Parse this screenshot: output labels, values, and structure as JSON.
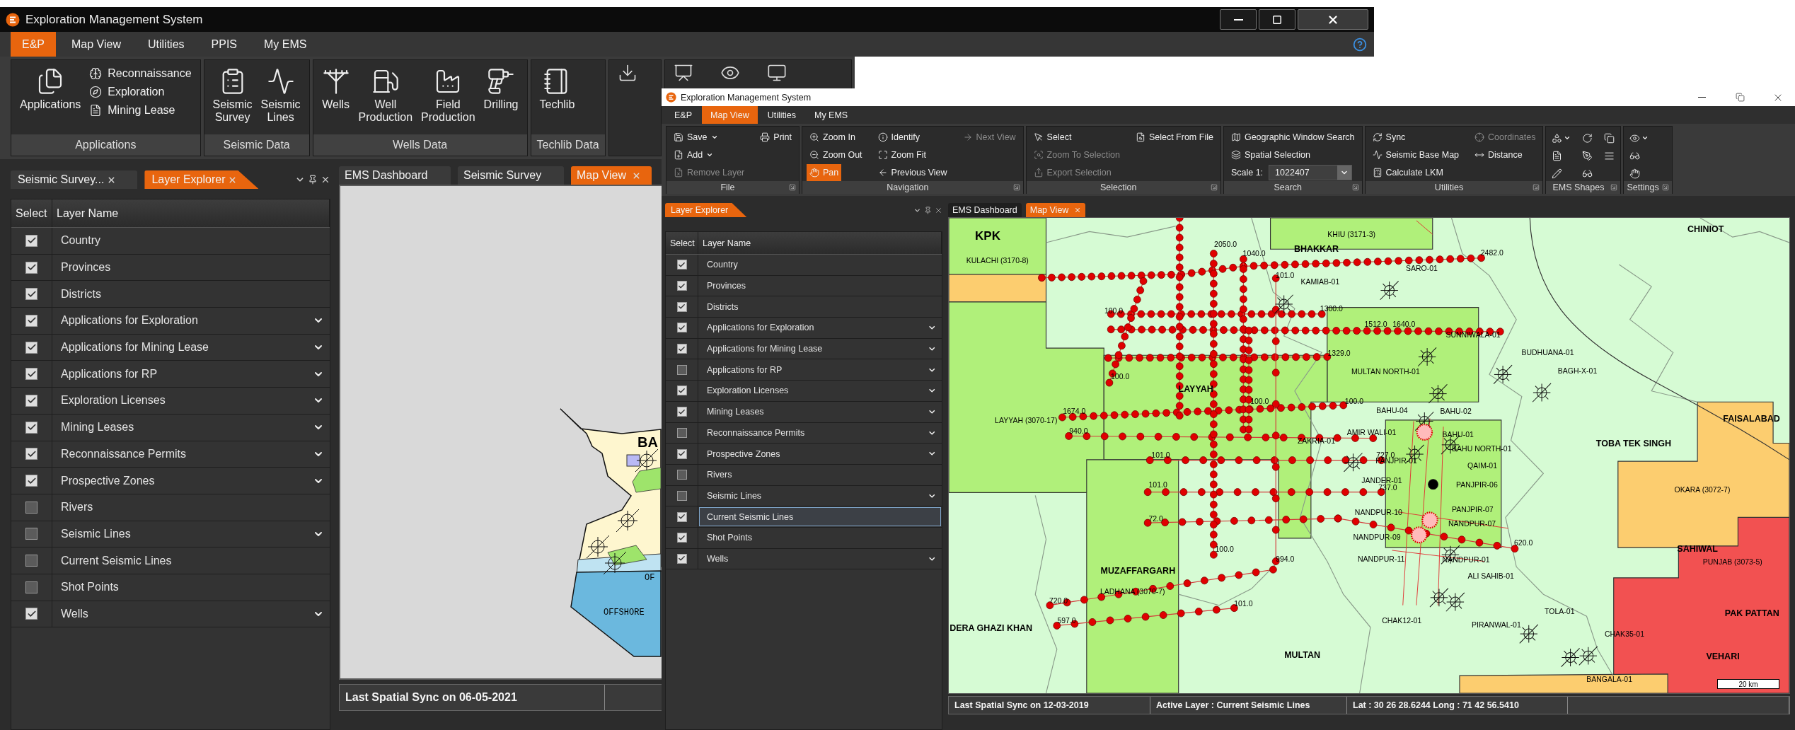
{
  "back_window": {
    "title": "Exploration Management System",
    "menu_tabs": [
      {
        "label": "E&P",
        "selected": true
      },
      {
        "label": "Map View",
        "selected": false
      },
      {
        "label": "Utilities",
        "selected": false
      },
      {
        "label": "PPIS",
        "selected": false
      },
      {
        "label": "My EMS",
        "selected": false
      }
    ],
    "ribbon_groups": [
      {
        "label": "Applications",
        "buttons": [
          {
            "label": "Applications",
            "kind": "large"
          },
          {
            "label": "Reconnaissance",
            "kind": "small"
          },
          {
            "label": "Exploration",
            "kind": "small"
          },
          {
            "label": "Mining Lease",
            "kind": "small"
          }
        ]
      },
      {
        "label": "Seismic Data",
        "buttons": [
          {
            "label": "Seismic Survey",
            "kind": "large"
          },
          {
            "label": "Seismic Lines",
            "kind": "large"
          }
        ]
      },
      {
        "label": "Wells Data",
        "buttons": [
          {
            "label": "Wells",
            "kind": "large"
          },
          {
            "label": "Well Production",
            "kind": "large"
          },
          {
            "label": "Field Production",
            "kind": "large"
          },
          {
            "label": "Drilling",
            "kind": "large"
          }
        ]
      },
      {
        "label": "Techlib Data",
        "buttons": [
          {
            "label": "Techlib",
            "kind": "large"
          }
        ]
      }
    ],
    "panel_tabs": [
      {
        "label": "Seismic Survey...",
        "selected": false
      },
      {
        "label": "Layer Explorer",
        "selected": true
      }
    ],
    "layer_table": {
      "columns": [
        "Select",
        "Layer Name"
      ],
      "layers": [
        {
          "name": "Country",
          "checked": true,
          "expandable": false,
          "selected": false
        },
        {
          "name": "Provinces",
          "checked": true,
          "expandable": false,
          "selected": false
        },
        {
          "name": "Districts",
          "checked": true,
          "expandable": false,
          "selected": false
        },
        {
          "name": "Applications for Exploration",
          "checked": true,
          "expandable": true,
          "selected": false
        },
        {
          "name": "Applications for Mining Lease",
          "checked": true,
          "expandable": true,
          "selected": false
        },
        {
          "name": "Applications for RP",
          "checked": true,
          "expandable": true,
          "selected": false
        },
        {
          "name": "Exploration Licenses",
          "checked": true,
          "expandable": true,
          "selected": false
        },
        {
          "name": "Mining Leases",
          "checked": true,
          "expandable": true,
          "selected": false
        },
        {
          "name": "Reconnaissance Permits",
          "checked": true,
          "expandable": true,
          "selected": false
        },
        {
          "name": "Prospective Zones",
          "checked": true,
          "expandable": true,
          "selected": false
        },
        {
          "name": "Rivers",
          "checked": false,
          "expandable": false,
          "selected": false
        },
        {
          "name": "Seismic Lines",
          "checked": false,
          "expandable": true,
          "selected": false
        },
        {
          "name": "Current Seismic Lines",
          "checked": false,
          "expandable": false,
          "selected": false
        },
        {
          "name": "Shot Points",
          "checked": false,
          "expandable": false,
          "selected": false
        },
        {
          "name": "Wells",
          "checked": true,
          "expandable": true,
          "selected": false
        }
      ]
    },
    "document_tabs": [
      {
        "label": "EMS Dashboard",
        "selected": false
      },
      {
        "label": "Seismic Survey",
        "selected": false
      },
      {
        "label": "Map View",
        "selected": true
      }
    ],
    "map_labels": [
      {
        "text": "BA",
        "kind": "place"
      },
      {
        "text": "OF",
        "kind": "sea"
      },
      {
        "text": "OFFSHORE",
        "kind": "sea"
      }
    ],
    "status_bar": [
      "Last Spatial Sync on 06-05-2021"
    ]
  },
  "front_window": {
    "title": "Exploration Management System",
    "menu_tabs": [
      {
        "label": "E&P",
        "selected": false
      },
      {
        "label": "Map View",
        "selected": true
      },
      {
        "label": "Utilities",
        "selected": false
      },
      {
        "label": "My EMS",
        "selected": false
      }
    ],
    "ribbon_groups": [
      {
        "label": "File",
        "kind": "commands",
        "columns": [
          [
            {
              "label": "Save",
              "kind": "dropdown",
              "disabled": false,
              "selected": false
            },
            {
              "label": "Add",
              "kind": "dropdown",
              "disabled": false,
              "selected": false
            },
            {
              "label": "Remove Layer",
              "kind": "button",
              "disabled": true,
              "selected": false
            }
          ],
          [
            {
              "label": "Print",
              "kind": "button",
              "disabled": false,
              "selected": false
            }
          ]
        ]
      },
      {
        "label": "Navigation",
        "kind": "commands",
        "columns": [
          [
            {
              "label": "Zoom In",
              "kind": "button",
              "disabled": false,
              "selected": false
            },
            {
              "label": "Zoom Out",
              "kind": "button",
              "disabled": false,
              "selected": false
            },
            {
              "label": "Pan",
              "kind": "button",
              "disabled": false,
              "selected": true
            }
          ],
          [
            {
              "label": "Identify",
              "kind": "button",
              "disabled": false,
              "selected": false
            },
            {
              "label": "Zoom Fit",
              "kind": "button",
              "disabled": false,
              "selected": false
            },
            {
              "label": "Previous View",
              "kind": "button",
              "disabled": false,
              "selected": false
            }
          ],
          [
            {
              "label": "Next View",
              "kind": "button",
              "disabled": true,
              "selected": false
            }
          ]
        ]
      },
      {
        "label": "Selection",
        "kind": "commands",
        "columns": [
          [
            {
              "label": "Select",
              "kind": "button",
              "disabled": false,
              "selected": false
            },
            {
              "label": "Zoom To Selection",
              "kind": "button",
              "disabled": true,
              "selected": false
            },
            {
              "label": "Export Selection",
              "kind": "button",
              "disabled": true,
              "selected": false
            }
          ],
          [
            {
              "label": "Select From File",
              "kind": "button",
              "disabled": false,
              "selected": false
            }
          ]
        ]
      },
      {
        "label": "Search",
        "kind": "commands",
        "columns": [
          [
            {
              "label": "Geographic Window Search",
              "kind": "button",
              "disabled": false,
              "selected": false
            },
            {
              "label": "Spatial Selection",
              "kind": "button",
              "disabled": false,
              "selected": false
            },
            {
              "label": "Scale 1:",
              "kind": "combo",
              "value": "1022407",
              "disabled": false
            }
          ]
        ]
      },
      {
        "label": "Utilities",
        "kind": "commands",
        "columns": [
          [
            {
              "label": "Sync",
              "kind": "button",
              "disabled": false,
              "selected": false
            },
            {
              "label": "Seismic Base Map",
              "kind": "button",
              "disabled": false,
              "selected": false
            },
            {
              "label": "Calculate LKM",
              "kind": "button",
              "disabled": false,
              "selected": false
            }
          ],
          [
            {
              "label": "Coordinates",
              "kind": "button",
              "disabled": true,
              "selected": false
            },
            {
              "label": "Distance",
              "kind": "button",
              "disabled": false,
              "selected": false
            }
          ]
        ]
      },
      {
        "label": "EMS Shapes",
        "kind": "shapes"
      },
      {
        "label": "Settings",
        "kind": "settings"
      }
    ],
    "panel_tabs": [
      {
        "label": "Layer Explorer",
        "selected": true
      }
    ],
    "layer_table": {
      "columns": [
        "Select",
        "Layer Name"
      ],
      "layers": [
        {
          "name": "Country",
          "checked": true,
          "expandable": false,
          "selected": false
        },
        {
          "name": "Provinces",
          "checked": true,
          "expandable": false,
          "selected": false
        },
        {
          "name": "Districts",
          "checked": true,
          "expandable": false,
          "selected": false
        },
        {
          "name": "Applications for Exploration",
          "checked": true,
          "expandable": true,
          "selected": false
        },
        {
          "name": "Applications for Mining Lease",
          "checked": true,
          "expandable": true,
          "selected": false
        },
        {
          "name": "Applications for RP",
          "checked": false,
          "expandable": true,
          "selected": false
        },
        {
          "name": "Exploration Licenses",
          "checked": true,
          "expandable": true,
          "selected": false
        },
        {
          "name": "Mining Leases",
          "checked": true,
          "expandable": true,
          "selected": false
        },
        {
          "name": "Reconnaissance Permits",
          "checked": false,
          "expandable": true,
          "selected": false
        },
        {
          "name": "Prospective Zones",
          "checked": true,
          "expandable": true,
          "selected": false
        },
        {
          "name": "Rivers",
          "checked": false,
          "expandable": false,
          "selected": false
        },
        {
          "name": "Seismic Lines",
          "checked": false,
          "expandable": true,
          "selected": false
        },
        {
          "name": "Current Seismic Lines",
          "checked": true,
          "expandable": false,
          "selected": true
        },
        {
          "name": "Shot Points",
          "checked": true,
          "expandable": false,
          "selected": false
        },
        {
          "name": "Wells",
          "checked": true,
          "expandable": true,
          "selected": false
        }
      ]
    },
    "document_tabs": [
      {
        "label": "EMS Dashboard",
        "selected": false
      },
      {
        "label": "Map View",
        "selected": true
      }
    ],
    "map": {
      "labels": [
        {
          "text": "KPK",
          "kind": "region"
        },
        {
          "text": "KHIU (3171-3)",
          "kind": "site"
        },
        {
          "text": "CHINIOT",
          "kind": "place"
        },
        {
          "text": "2050.0",
          "kind": "value"
        },
        {
          "text": "BHAKKAR",
          "kind": "place"
        },
        {
          "text": "1040.0",
          "kind": "value"
        },
        {
          "text": "2482.0",
          "kind": "value"
        },
        {
          "text": "KULACHI (3170-8)",
          "kind": "site"
        },
        {
          "text": "SARO-01",
          "kind": "site"
        },
        {
          "text": "101.0",
          "kind": "value"
        },
        {
          "text": "KAMIAB-01",
          "kind": "site"
        },
        {
          "text": "1300.0",
          "kind": "value"
        },
        {
          "text": "100.0",
          "kind": "value"
        },
        {
          "text": "1512.0",
          "kind": "value"
        },
        {
          "text": "1640.0",
          "kind": "value"
        },
        {
          "text": "SUNNIWALA-01",
          "kind": "site"
        },
        {
          "text": "BUDHUANA-01",
          "kind": "site"
        },
        {
          "text": "1329.0",
          "kind": "value"
        },
        {
          "text": "BAGH-X-01",
          "kind": "site"
        },
        {
          "text": "MULTAN NORTH-01",
          "kind": "site"
        },
        {
          "text": "100.0",
          "kind": "value"
        },
        {
          "text": "LAYYAH",
          "kind": "place"
        },
        {
          "text": "100.0",
          "kind": "value"
        },
        {
          "text": "100.0",
          "kind": "value"
        },
        {
          "text": "1674.0",
          "kind": "value"
        },
        {
          "text": "BAHU-04",
          "kind": "site"
        },
        {
          "text": "BAHU-02",
          "kind": "site"
        },
        {
          "text": "FAISALABAD",
          "kind": "place"
        },
        {
          "text": "LAYYAH (3070-17)",
          "kind": "site"
        },
        {
          "text": "940.0",
          "kind": "value"
        },
        {
          "text": "AMIR WALI-01",
          "kind": "site"
        },
        {
          "text": "BAHU-01",
          "kind": "site"
        },
        {
          "text": "ZAKRIA-01",
          "kind": "site"
        },
        {
          "text": "TOBA TEK SINGH",
          "kind": "place"
        },
        {
          "text": "BAHU NORTH-01",
          "kind": "site"
        },
        {
          "text": "101.0",
          "kind": "value"
        },
        {
          "text": "727.0",
          "kind": "value"
        },
        {
          "text": "PANJPIR-01",
          "kind": "site"
        },
        {
          "text": "QAIM-01",
          "kind": "site"
        },
        {
          "text": "JANDER-01",
          "kind": "site"
        },
        {
          "text": "101.0",
          "kind": "value"
        },
        {
          "text": "PANJPIR-06",
          "kind": "site"
        },
        {
          "text": "737.0",
          "kind": "value"
        },
        {
          "text": "OKARA (3072-7)",
          "kind": "site"
        },
        {
          "text": "PANJPIR-07",
          "kind": "site"
        },
        {
          "text": "72.0",
          "kind": "value"
        },
        {
          "text": "NANDPUR-10",
          "kind": "site"
        },
        {
          "text": "NANDPUR-07",
          "kind": "site"
        },
        {
          "text": "NANDPUR-09",
          "kind": "site"
        },
        {
          "text": "620.0",
          "kind": "value"
        },
        {
          "text": "100.0",
          "kind": "value"
        },
        {
          "text": "SAHIWAL",
          "kind": "place"
        },
        {
          "text": "994.0",
          "kind": "value"
        },
        {
          "text": "NANDPUR-11",
          "kind": "site"
        },
        {
          "text": "NANDPUR-01",
          "kind": "site"
        },
        {
          "text": "PUNJAB (3073-5)",
          "kind": "site"
        },
        {
          "text": "MUZAFFARGARH",
          "kind": "place"
        },
        {
          "text": "ALI SAHIB-01",
          "kind": "site"
        },
        {
          "text": "LADHANA (3070-7)",
          "kind": "site"
        },
        {
          "text": "720.0",
          "kind": "value"
        },
        {
          "text": "101.0",
          "kind": "value"
        },
        {
          "text": "TOLA-01",
          "kind": "site"
        },
        {
          "text": "PAK PATTAN",
          "kind": "place"
        },
        {
          "text": "DERA GHAZI KHAN",
          "kind": "place"
        },
        {
          "text": "597.0",
          "kind": "value"
        },
        {
          "text": "CHAK12-01",
          "kind": "site"
        },
        {
          "text": "PIRANWAL-01",
          "kind": "site"
        },
        {
          "text": "CHAK35-01",
          "kind": "site"
        },
        {
          "text": "MULTAN",
          "kind": "place"
        },
        {
          "text": "VEHARI",
          "kind": "place"
        },
        {
          "text": "BANGALA-01",
          "kind": "site"
        }
      ],
      "scale_bar": "20 km"
    },
    "status_bar": [
      "Last Spatial Sync on 12-03-2019",
      "Active Layer : Current Seismic Lines",
      "Lat : 30 26 28.6244  Long : 71 42 56.5410"
    ]
  }
}
